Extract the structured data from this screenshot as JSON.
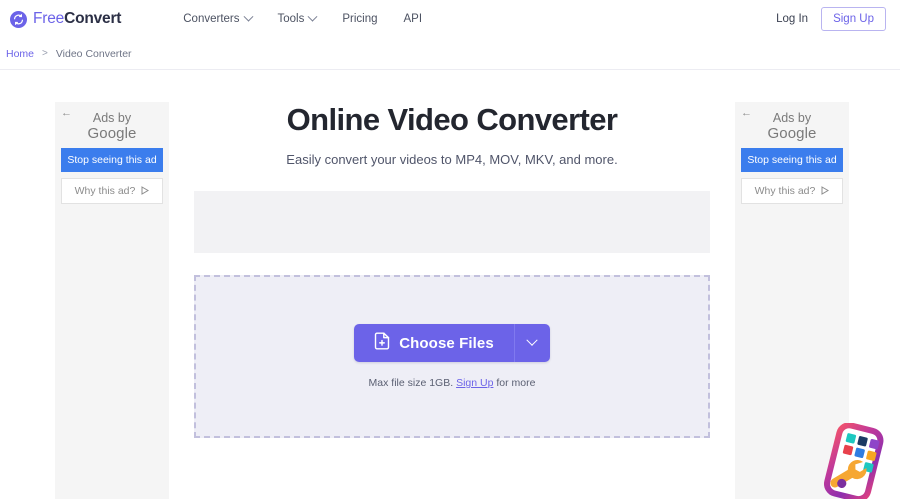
{
  "header": {
    "logo": {
      "icon": "convert-circle-icon",
      "text_primary": "Free",
      "text_secondary": "Convert"
    },
    "nav": [
      {
        "label": "Converters",
        "has_dropdown": true
      },
      {
        "label": "Tools",
        "has_dropdown": true
      },
      {
        "label": "Pricing",
        "has_dropdown": false
      },
      {
        "label": "API",
        "has_dropdown": false
      }
    ],
    "login_label": "Log In",
    "signup_label": "Sign Up"
  },
  "breadcrumb": {
    "home_label": "Home",
    "separator": ">",
    "current_label": "Video Converter"
  },
  "ads": {
    "back_arrow": "←",
    "ads_by_line1": "Ads by",
    "ads_by_line2": "Google",
    "stop_label": "Stop seeing this ad",
    "why_label": "Why this ad?",
    "stop_color": "#3b7ded"
  },
  "main": {
    "title": "Online Video Converter",
    "subtitle": "Easily convert your videos to MP4, MOV, MKV, and more.",
    "choose_files_label": "Choose Files",
    "choose_files_icon": "file-plus-icon",
    "dropdown_icon": "chevron-down-icon",
    "max_size_prefix": "Max file size 1GB.",
    "max_size_link": "Sign Up",
    "max_size_suffix": "for more",
    "accent_color": "#6c63e8"
  },
  "corner_graphic": {
    "name": "phone-tools-icon"
  }
}
